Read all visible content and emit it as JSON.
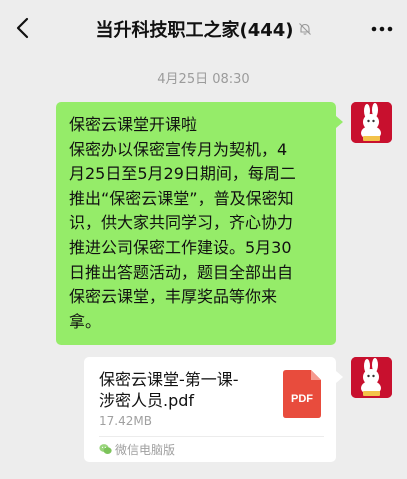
{
  "header": {
    "title": "当升科技职工之家(444)",
    "back_icon": "chevron-left-icon",
    "mute_icon": "bell-muted-icon",
    "more_icon": "more-dots-icon"
  },
  "chat": {
    "timestamp": "4月25日 08:30",
    "message_text_lines": [
      "保密云课堂开课啦",
      "保密办以保密宣传月为契机，4",
      "月25日至5月29日期间，每周二",
      "推出“保密云课堂”，普及保密知",
      "识，供大家共同学习，齐心协力",
      "推进公司保密工作建设。5月30",
      "日推出答题活动，题目全部出自",
      "保密云课堂，丰厚奖品等你来",
      "拿。"
    ],
    "file": {
      "name_lines": [
        "保密云课堂-第一课-",
        "涉密人员.pdf"
      ],
      "size": "17.42MB",
      "type_label": "PDF",
      "source": "微信电脑版",
      "source_icon": "wechat-pc-icon"
    }
  },
  "colors": {
    "background": "#ededed",
    "bubble_green": "#95ec69",
    "pdf_red": "#e84c3d",
    "avatar_red": "#c8102e"
  }
}
